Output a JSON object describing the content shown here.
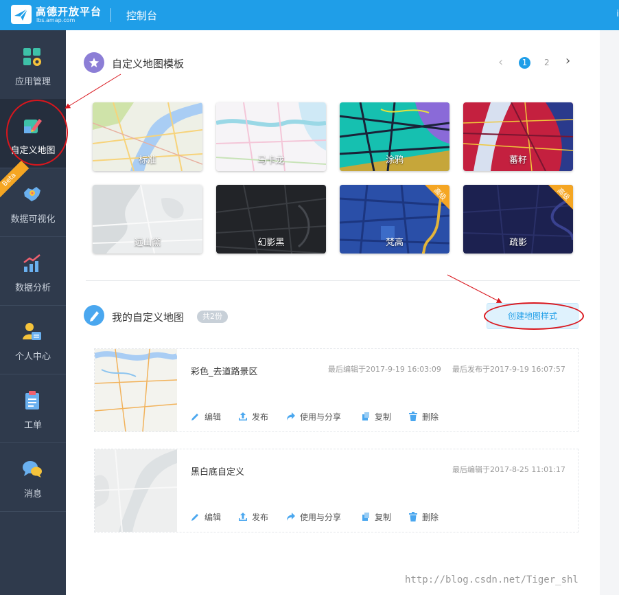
{
  "header": {
    "brand": "高德开放平台",
    "brand_url": "lbs.amap.com",
    "console": "控制台",
    "right_text": "i"
  },
  "sidebar": {
    "items": [
      {
        "label": "应用管理",
        "icon": "grid-gear-icon"
      },
      {
        "label": "自定义地图",
        "icon": "map-pencil-icon"
      },
      {
        "label": "数据可视化",
        "icon": "china-map-icon",
        "badge": "Beta"
      },
      {
        "label": "数据分析",
        "icon": "bar-chart-icon"
      },
      {
        "label": "个人中心",
        "icon": "user-card-icon"
      },
      {
        "label": "工单",
        "icon": "clipboard-icon"
      },
      {
        "label": "消息",
        "icon": "chat-bubbles-icon"
      }
    ]
  },
  "templates": {
    "title": "自定义地图模板",
    "pager": {
      "prev": "‹",
      "page1": "1",
      "page2": "2",
      "next": "›"
    },
    "tiles": [
      {
        "label": "标准"
      },
      {
        "label": "马卡龙"
      },
      {
        "label": "涂鸦"
      },
      {
        "label": "蕃籽"
      },
      {
        "label": "远山黛"
      },
      {
        "label": "幻影黑"
      },
      {
        "label": "梵高",
        "tag": "高级"
      },
      {
        "label": "疏影",
        "tag": "高级"
      }
    ]
  },
  "mymaps": {
    "title": "我的自定义地图",
    "count": "共2份",
    "create": "创建地图样式",
    "actions": {
      "edit": "编辑",
      "publish": "发布",
      "share": "使用与分享",
      "copy": "复制",
      "delete": "删除"
    },
    "cards": [
      {
        "name": "彩色_去道路景区",
        "edited": "最后编辑于2017-9-19 16:03:09",
        "published": "最后发布于2017-9-19 16:07:57"
      },
      {
        "name": "黑白底自定义",
        "edited": "最后编辑于2017-8-25 11:01:17"
      }
    ]
  },
  "watermark": "http://blog.csdn.net/Tiger_shl",
  "colors": {
    "brand": "#1f9ee8",
    "sidebar": "#2f3a4c",
    "accent_red": "#d9161d",
    "badge": "#f5a623"
  }
}
